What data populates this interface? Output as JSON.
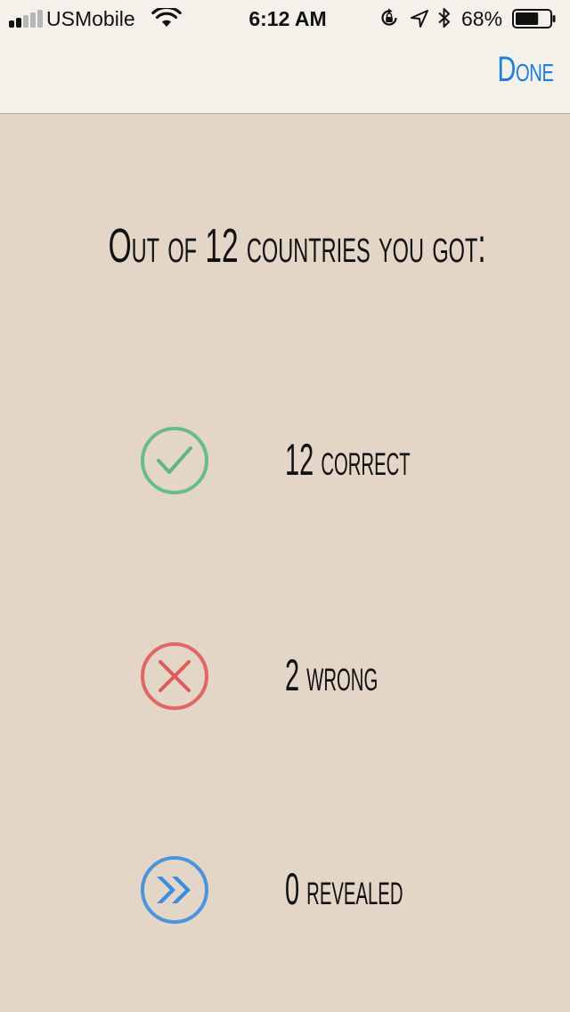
{
  "status_bar": {
    "carrier": "USMobile",
    "time": "6:12 AM",
    "battery_percent": "68%",
    "battery_level": 0.68,
    "signal_bars_filled": 2,
    "signal_bars_total": 5,
    "icons": [
      "signal-icon",
      "wifi-icon",
      "rotation-lock-icon",
      "location-icon",
      "bluetooth-icon",
      "battery-icon"
    ]
  },
  "nav": {
    "done_label": "Done",
    "accent_color": "#1a7fe0"
  },
  "summary": {
    "headline": "Out of 12 countries you got:"
  },
  "results": [
    {
      "label": "12 correct",
      "icon": "check-circle-icon",
      "color": "#5bb886"
    },
    {
      "label": "2 wrong",
      "icon": "x-circle-icon",
      "color": "#e05a5a"
    },
    {
      "label": "0 revealed",
      "icon": "double-chevron-circle-icon",
      "color": "#3b8de0"
    }
  ],
  "colors": {
    "background": "#e4d6c7",
    "topbar": "#f4f0ea"
  }
}
